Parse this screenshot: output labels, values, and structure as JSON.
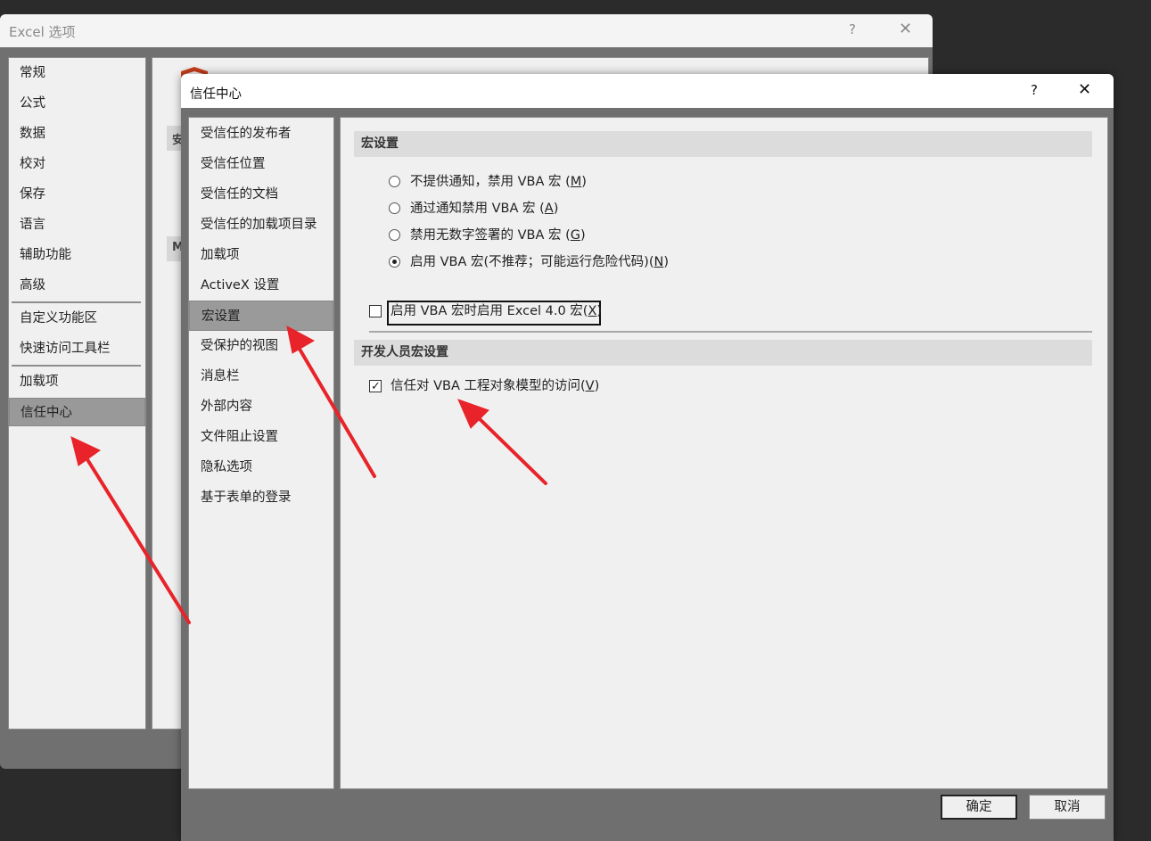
{
  "excel_options": {
    "title": "Excel 选项",
    "help": "?",
    "close": "✕",
    "nav": [
      {
        "label": "常规"
      },
      {
        "label": "公式"
      },
      {
        "label": "数据"
      },
      {
        "label": "校对"
      },
      {
        "label": "保存"
      },
      {
        "label": "语言"
      },
      {
        "label": "辅助功能"
      },
      {
        "label": "高级"
      },
      {
        "label": "自定义功能区"
      },
      {
        "label": "快速访问工具栏"
      },
      {
        "label": "加载项"
      },
      {
        "label": "信任中心"
      }
    ],
    "selected": "信任中心",
    "partial_section_1": "安",
    "partial_section_2": "M"
  },
  "trust_center": {
    "title": "信任中心",
    "help": "?",
    "close": "✕",
    "nav": [
      {
        "label": "受信任的发布者"
      },
      {
        "label": "受信任位置"
      },
      {
        "label": "受信任的文档"
      },
      {
        "label": "受信任的加载项目录"
      },
      {
        "label": "加载项"
      },
      {
        "label": "ActiveX 设置"
      },
      {
        "label": "宏设置"
      },
      {
        "label": "受保护的视图"
      },
      {
        "label": "消息栏"
      },
      {
        "label": "外部内容"
      },
      {
        "label": "文件阻止设置"
      },
      {
        "label": "隐私选项"
      },
      {
        "label": "基于表单的登录"
      }
    ],
    "selected": "宏设置",
    "macro_section_title": "宏设置",
    "radio_options": [
      {
        "text": "不提供通知，禁用 VBA 宏 (",
        "key": "M",
        "end": ")",
        "checked": false
      },
      {
        "text": "通过通知禁用 VBA 宏 (",
        "key": "A",
        "end": ")",
        "checked": false
      },
      {
        "text": "禁用无数字签署的 VBA 宏 (",
        "key": "G",
        "end": ")",
        "checked": false
      },
      {
        "text": "启用 VBA 宏(不推荐；可能运行危险代码)(",
        "key": "N",
        "end": ")",
        "checked": true
      }
    ],
    "excel4_checkbox": {
      "text": "启用 VBA 宏时启用 Excel 4.0 宏(",
      "key": "X",
      "end": ")",
      "checked": false
    },
    "dev_section_title": "开发人员宏设置",
    "vba_access_checkbox": {
      "text": "信任对 VBA 工程对象模型的访问(",
      "key": "V",
      "end": ")",
      "checked": true
    },
    "ok_button": "确定",
    "cancel_button": "取消"
  },
  "colors": {
    "annotation_arrow": "#e8232a",
    "shield": "#c8401c"
  }
}
